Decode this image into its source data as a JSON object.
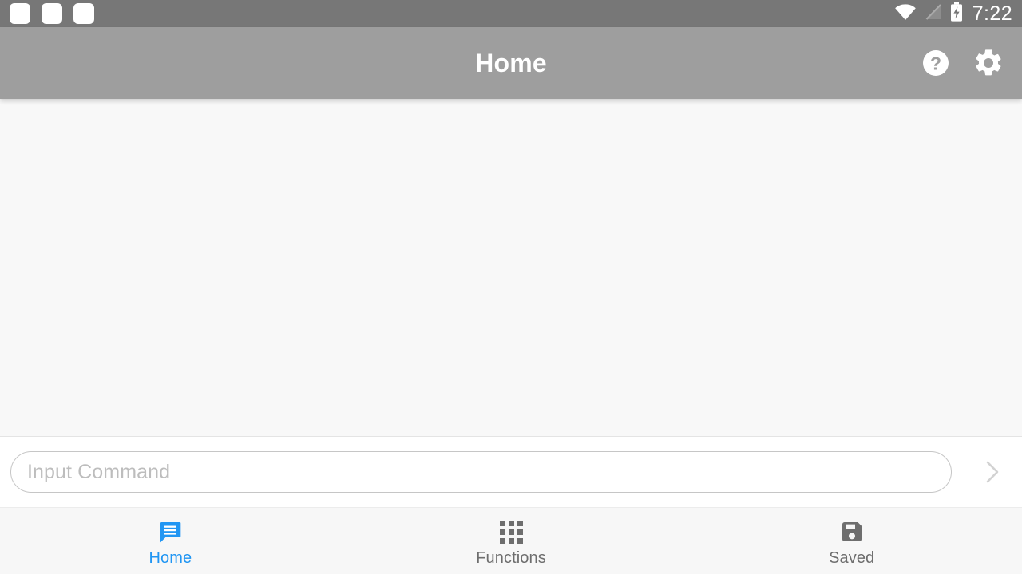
{
  "status_bar": {
    "notification_count": 3,
    "icons": [
      "wifi-icon",
      "signal-off-icon",
      "battery-charging-icon"
    ],
    "time": "7:22",
    "background": "#777777"
  },
  "toolbar": {
    "title": "Home",
    "background": "#9e9e9e",
    "actions": [
      {
        "name": "help-icon",
        "label": "Help"
      },
      {
        "name": "settings-icon",
        "label": "Settings"
      }
    ]
  },
  "content": {
    "background": "#f8f8f8",
    "messages": []
  },
  "input_bar": {
    "placeholder": "Input Command",
    "value": "",
    "send_icon": "chevron-right-icon"
  },
  "bottom_nav": {
    "active_color": "#2196f3",
    "inactive_color": "#6e6e6e",
    "items": [
      {
        "label": "Home",
        "icon": "chat-icon",
        "active": true
      },
      {
        "label": "Functions",
        "icon": "grid-icon",
        "active": false
      },
      {
        "label": "Saved",
        "icon": "floppy-disk-icon",
        "active": false
      }
    ]
  }
}
